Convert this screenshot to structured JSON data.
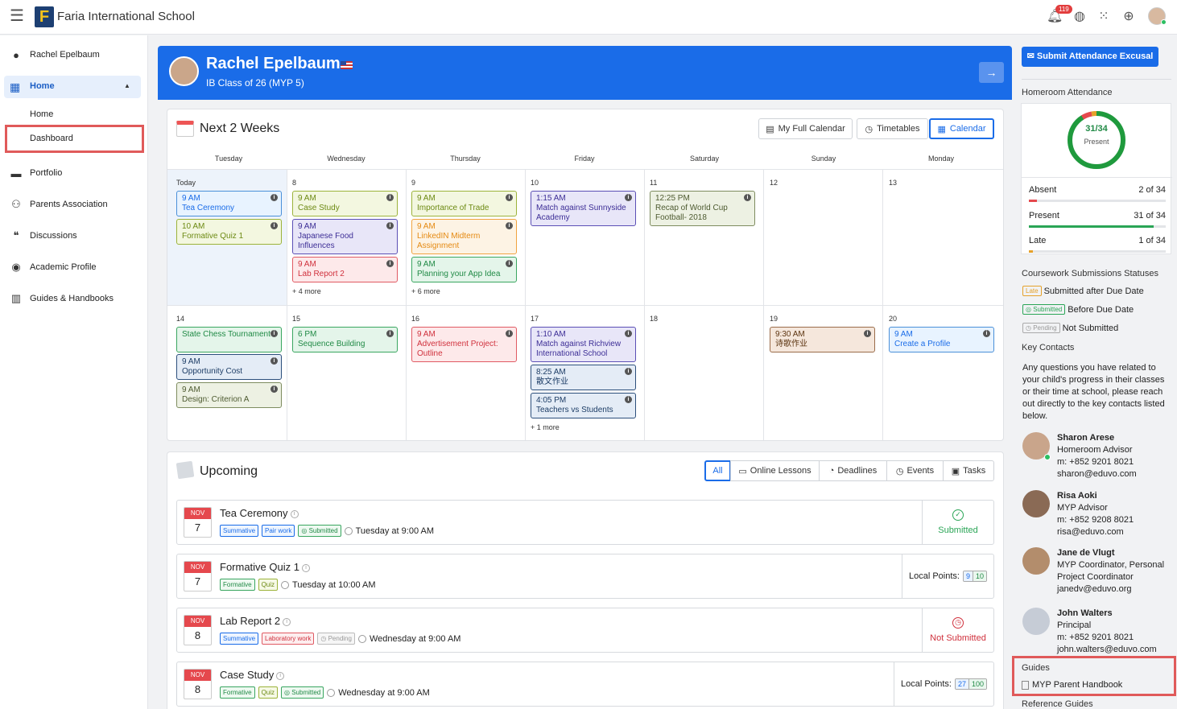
{
  "app": {
    "school_name": "Faria International School",
    "notifications": "119"
  },
  "sidebar": {
    "user": "Rachel Epelbaum",
    "home": "Home",
    "sub": [
      "Home",
      "Dashboard"
    ],
    "items": [
      "Portfolio",
      "Parents Association",
      "Discussions",
      "Academic Profile",
      "Guides & Handbooks"
    ]
  },
  "banner": {
    "name": "Rachel Epelbaum",
    "class": "IB Class of 26 (MYP 5)"
  },
  "calendar": {
    "title": "Next 2 Weeks",
    "buttons": [
      "My Full Calendar",
      "Timetables",
      "Calendar"
    ],
    "days": [
      "Tuesday",
      "Wednesday",
      "Thursday",
      "Friday",
      "Saturday",
      "Sunday",
      "Monday"
    ],
    "week1_dates": [
      "Today",
      "8",
      "9",
      "10",
      "11",
      "12",
      "13"
    ],
    "week2_dates": [
      "14",
      "15",
      "16",
      "17",
      "18",
      "19",
      "20"
    ],
    "events": [
      {
        "time": "9 AM",
        "title": "Tea Ceremony"
      },
      {
        "time": "10 AM",
        "title": "Formative Quiz 1"
      },
      {
        "time": "9 AM",
        "title": "Case Study"
      },
      {
        "time": "9 AM",
        "title": "Japanese Food Influences"
      },
      {
        "time": "9 AM",
        "title": "Lab Report 2"
      },
      {
        "time": "9 AM",
        "title": "Importance of Trade"
      },
      {
        "time": "9 AM",
        "title": "LinkedIN Midterm Assignment"
      },
      {
        "time": "9 AM",
        "title": "Planning your App Idea"
      },
      {
        "time": "1:15 AM",
        "title": "Match against Sunnyside Academy"
      },
      {
        "time": "12:25 PM",
        "title": "Recap of World Cup Football- 2018"
      },
      {
        "time": "",
        "title": "State Chess Tournament"
      },
      {
        "time": "9 AM",
        "title": "Opportunity Cost"
      },
      {
        "time": "9 AM",
        "title": "Design: Criterion A"
      },
      {
        "time": "6 PM",
        "title": "Sequence Building"
      },
      {
        "time": "9 AM",
        "title": "Advertisement Project: Outline"
      },
      {
        "time": "1:10 AM",
        "title": "Match against Richview International School"
      },
      {
        "time": "8:25 AM",
        "title": "散文作业"
      },
      {
        "time": "4:05 PM",
        "title": "Teachers vs Students"
      },
      {
        "time": "9:30 AM",
        "title": "诗歌作业"
      },
      {
        "time": "9 AM",
        "title": "Create a Profile"
      }
    ],
    "more": [
      "+ 4 more",
      "+ 6 more",
      "+ 1 more"
    ]
  },
  "upcoming": {
    "title": "Upcoming",
    "filters": [
      "All",
      "Online Lessons",
      "Deadlines",
      "Events",
      "Tasks"
    ],
    "rows": [
      {
        "month": "NOV",
        "day": "7",
        "title": "Tea Ceremony",
        "tags": [
          "Summative",
          "Pair work",
          "Submitted"
        ],
        "when": "Tuesday at 9:00 AM",
        "status": "Submitted"
      },
      {
        "month": "NOV",
        "day": "7",
        "title": "Formative Quiz 1",
        "tags": [
          "Formative",
          "Quiz"
        ],
        "when": "Tuesday at 10:00 AM",
        "points_label": "Local Points:",
        "points": [
          "9",
          "10"
        ]
      },
      {
        "month": "NOV",
        "day": "8",
        "title": "Lab Report 2",
        "tags": [
          "Summative",
          "Laboratory work",
          "Pending"
        ],
        "when": "Wednesday at 9:00 AM",
        "status": "Not Submitted"
      },
      {
        "month": "NOV",
        "day": "8",
        "title": "Case Study",
        "tags": [
          "Formative",
          "Quiz",
          "Submitted"
        ],
        "when": "Wednesday at 9:00 AM",
        "points_label": "Local Points:",
        "points": [
          "27",
          "100"
        ]
      }
    ]
  },
  "right": {
    "excuse_button": "Submit Attendance Excusal",
    "homeroom_title": "Homeroom Attendance",
    "attendance_value": "31/34",
    "attendance_label": "Present",
    "present_fraction": 0.912,
    "rows": [
      {
        "label": "Absent",
        "value": "2 of 34",
        "fraction": 0.059,
        "color": "#e5484d"
      },
      {
        "label": "Present",
        "value": "31 of 34",
        "fraction": 0.912,
        "color": "#2aa556"
      },
      {
        "label": "Late",
        "value": "1 of 34",
        "fraction": 0.029,
        "color": "#e5a12a"
      }
    ],
    "coursework_title": "Coursework Submissions Statuses",
    "legend": [
      {
        "tag": "Late",
        "text": "Submitted after Due Date"
      },
      {
        "tag": "Submitted",
        "text": "Before Due Date"
      },
      {
        "tag": "Pending",
        "text": "Not Submitted"
      }
    ],
    "key_contacts_title": "Key Contacts",
    "key_contacts_text": "Any questions you have related to your child's progress in their classes or their time at school, please reach out directly to the key contacts listed below.",
    "contacts": [
      {
        "name": "Sharon Arese",
        "role": "Homeroom Advisor",
        "phone": "m: +852 9201 8021",
        "email": "sharon@eduvo.com"
      },
      {
        "name": "Risa Aoki",
        "role": "MYP Advisor",
        "phone": "m: +852 9208 8021",
        "email": "risa@eduvo.com"
      },
      {
        "name": "Jane de Vlugt",
        "role": "MYP Coordinator, Personal Project Coordinator",
        "phone": "",
        "email": "janedv@eduvo.org"
      },
      {
        "name": "John Walters",
        "role": "Principal",
        "phone": "m: +852 9201 8021",
        "email": "john.walters@eduvo.com"
      }
    ],
    "guides_title": "Guides",
    "guide_item": "MYP Parent Handbook",
    "reference_title": "Reference Guides"
  },
  "colors": {
    "accent": "#1a6ce8",
    "highlight_box": "#e05a5a"
  }
}
